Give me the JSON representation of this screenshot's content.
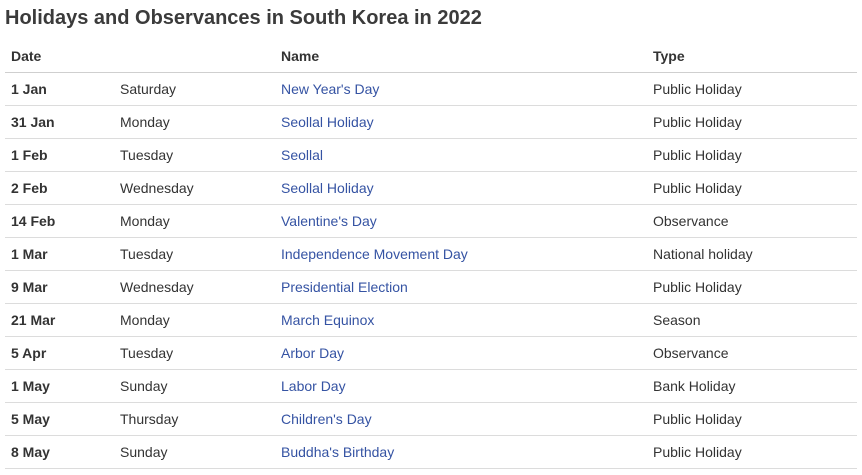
{
  "title": "Holidays and Observances in South Korea in 2022",
  "columns": {
    "date": "Date",
    "day": "",
    "name": "Name",
    "type": "Type"
  },
  "rows": [
    {
      "date": "1 Jan",
      "day": "Saturday",
      "name": "New Year's Day",
      "type": "Public Holiday"
    },
    {
      "date": "31 Jan",
      "day": "Monday",
      "name": "Seollal Holiday",
      "type": "Public Holiday"
    },
    {
      "date": "1 Feb",
      "day": "Tuesday",
      "name": "Seollal",
      "type": "Public Holiday"
    },
    {
      "date": "2 Feb",
      "day": "Wednesday",
      "name": "Seollal Holiday",
      "type": "Public Holiday"
    },
    {
      "date": "14 Feb",
      "day": "Monday",
      "name": "Valentine's Day",
      "type": "Observance"
    },
    {
      "date": "1 Mar",
      "day": "Tuesday",
      "name": "Independence Movement Day",
      "type": "National holiday"
    },
    {
      "date": "9 Mar",
      "day": "Wednesday",
      "name": "Presidential Election",
      "type": "Public Holiday"
    },
    {
      "date": "21 Mar",
      "day": "Monday",
      "name": "March Equinox",
      "type": "Season"
    },
    {
      "date": "5 Apr",
      "day": "Tuesday",
      "name": "Arbor Day",
      "type": "Observance"
    },
    {
      "date": "1 May",
      "day": "Sunday",
      "name": "Labor Day",
      "type": "Bank Holiday"
    },
    {
      "date": "5 May",
      "day": "Thursday",
      "name": "Children's Day",
      "type": "Public Holiday"
    },
    {
      "date": "8 May",
      "day": "Sunday",
      "name": "Buddha's Birthday",
      "type": "Public Holiday"
    }
  ],
  "colors": {
    "link": "#3553a3",
    "text": "#333333",
    "row_border": "#dcdcdc"
  }
}
